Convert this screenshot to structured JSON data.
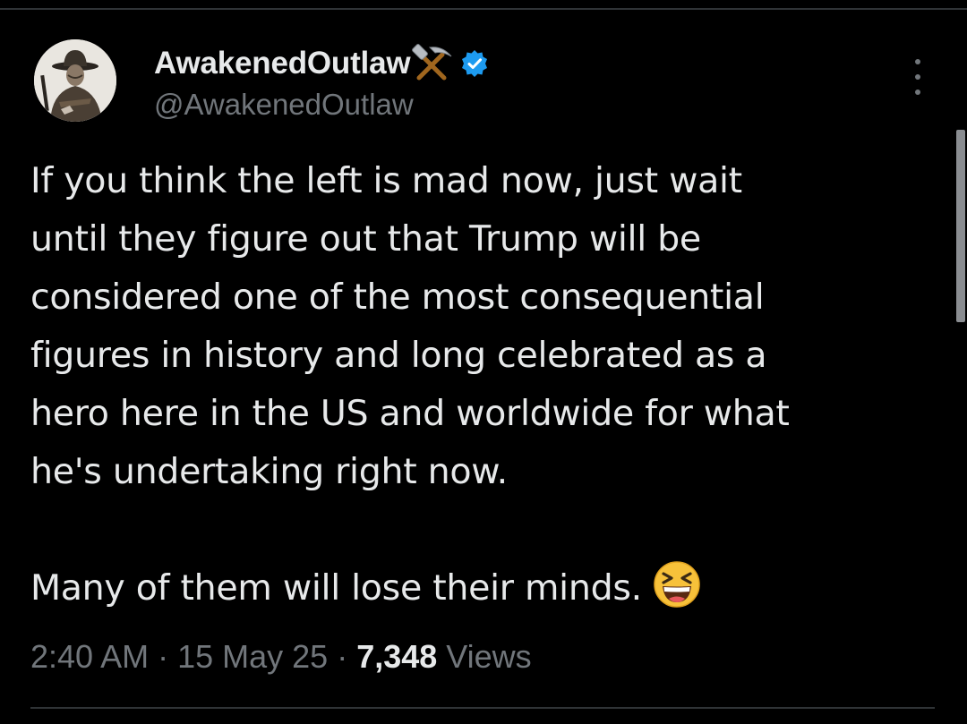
{
  "tweet": {
    "author": {
      "display_name": "AwakenedOutlaw",
      "name_emoji_icon": "hammer-and-pick-icon",
      "verified_icon": "verified-badge-icon",
      "verified_color": "#1d9bf0",
      "handle": "@AwakenedOutlaw"
    },
    "more_icon": "more-vertical-icon",
    "text_lines": [
      "If you think the left is mad now, just wait",
      "until they figure out that Trump will be",
      "considered one of the most consequential",
      "figures in history and long celebrated as a",
      "hero here in the US and worldwide for what",
      "he's undertaking right now."
    ],
    "text_last_line": "Many of them will lose their minds.",
    "text_emoji_icon": "grinning-squinting-face-icon",
    "time": "2:40 AM",
    "separator": "·",
    "date": "15 May 25",
    "views_count": "7,348",
    "views_label": "Views"
  },
  "colors": {
    "background": "#000000",
    "primary_text": "#e7e9ea",
    "secondary_text": "#71767b",
    "divider": "#2f3336"
  }
}
